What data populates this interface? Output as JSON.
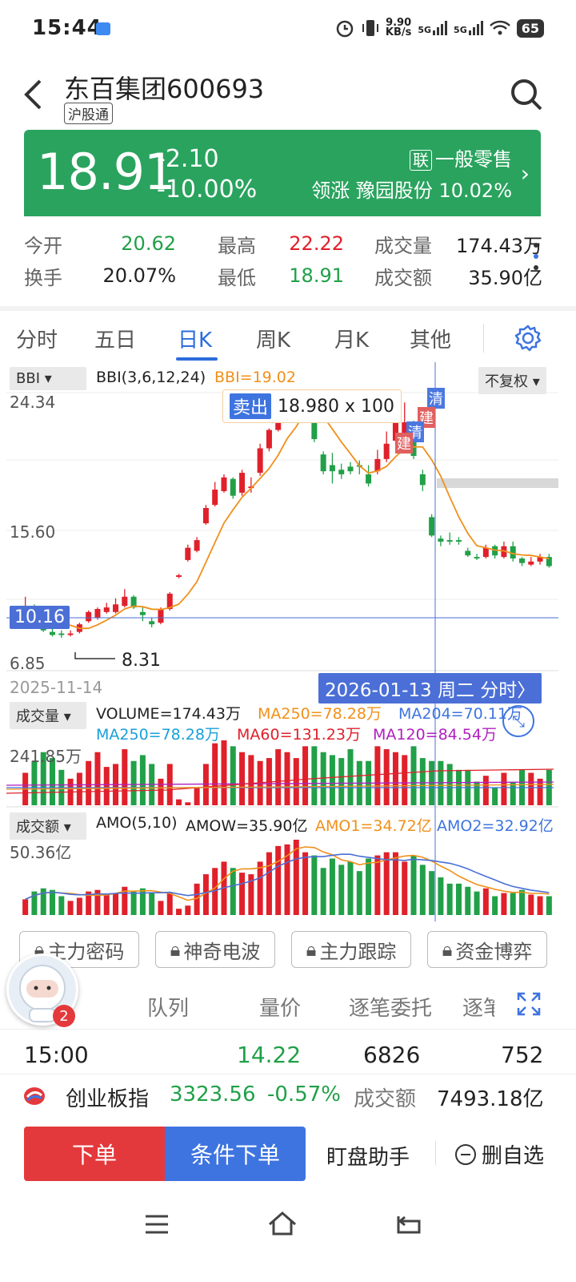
{
  "status": {
    "time": "15:44",
    "speed_top": "9.90",
    "speed_unit": "KB/s",
    "net1": "5G",
    "net2": "5G",
    "battery": "65"
  },
  "header": {
    "title": "东百集团600693",
    "tag": "沪股通"
  },
  "quote": {
    "price": "18.91",
    "change": "-2.10",
    "change_pct": "-10.00%",
    "lian_badge": "联",
    "sector": "一般零售",
    "leader_label": "领涨",
    "leader": "豫园股份 10.02%",
    "color_down": "#2aa35e"
  },
  "stats": {
    "open_label": "今开",
    "open": "20.62",
    "high_label": "最高",
    "high": "22.22",
    "vol_label": "成交量",
    "vol": "174.43万",
    "turnover_label": "换手",
    "turnover": "20.07%",
    "low_label": "最低",
    "low": "18.91",
    "amount_label": "成交额",
    "amount": "35.90亿"
  },
  "tabs": [
    "分时",
    "五日",
    "日K",
    "周K",
    "月K",
    "其他"
  ],
  "chart": {
    "indicator_select": "BBI",
    "indicator_name": "BBI(3,6,12,24)",
    "indicator_value": "BBI=19.02",
    "adjust_select": "不复权",
    "y_high": "24.34",
    "y_mid": "15.60",
    "y_low": "6.85",
    "crosshair_price": "10.16",
    "low_mark": "8.31",
    "tooltip_sell_label": "卖出",
    "tooltip_sell_value": "18.980 x 100",
    "mark_jian": "建",
    "mark_qing": "清",
    "date_left": "2025-11-14",
    "date_cursor": "2026-01-13 周二 分时〉",
    "vol_select": "成交量",
    "vol_text": "VOLUME=174.43万",
    "vol_ma250": "MA250=78.28万",
    "vol_ma204": "MA204=70.11万",
    "vol_ma250b": "MA250=78.28万",
    "vol_ma60": "MA60=131.23万",
    "vol_ma120": "MA120=84.54万",
    "vol_max": "241.85万",
    "amo_select": "成交额",
    "amo_text": "AMO(5,10)",
    "amow": "AMOW=35.90亿",
    "amo1": "AMO1=34.72亿",
    "amo2": "AMO2=32.92亿",
    "amo_max": "50.36亿"
  },
  "chart_data": {
    "type": "candlestick",
    "ylim": [
      6.85,
      24.34
    ],
    "candles": [
      {
        "o": 10.3,
        "c": 10.4,
        "h": 11.0,
        "l": 10.0
      },
      {
        "o": 10.2,
        "c": 10.0,
        "h": 10.5,
        "l": 9.9
      },
      {
        "o": 8.9,
        "c": 8.8,
        "h": 9.0,
        "l": 8.7
      },
      {
        "o": 8.7,
        "c": 8.5,
        "h": 8.9,
        "l": 8.4
      },
      {
        "o": 8.6,
        "c": 8.5,
        "h": 8.8,
        "l": 8.31
      },
      {
        "o": 8.5,
        "c": 8.6,
        "h": 8.8,
        "l": 8.4
      },
      {
        "o": 8.7,
        "c": 9.2,
        "h": 9.3,
        "l": 8.6
      },
      {
        "o": 9.4,
        "c": 10.0,
        "h": 10.1,
        "l": 9.3
      },
      {
        "o": 9.6,
        "c": 10.2,
        "h": 10.3,
        "l": 9.5
      },
      {
        "o": 10.0,
        "c": 10.3,
        "h": 10.6,
        "l": 9.9
      },
      {
        "o": 10.0,
        "c": 10.5,
        "h": 10.9,
        "l": 9.9
      },
      {
        "o": 10.4,
        "c": 11.0,
        "h": 11.5,
        "l": 10.3
      },
      {
        "o": 11.0,
        "c": 10.3,
        "h": 11.1,
        "l": 10.2
      },
      {
        "o": 10.0,
        "c": 9.8,
        "h": 10.3,
        "l": 9.4
      },
      {
        "o": 9.4,
        "c": 9.2,
        "h": 9.6,
        "l": 9.0
      },
      {
        "o": 9.3,
        "c": 10.2,
        "h": 10.3,
        "l": 9.2
      },
      {
        "o": 10.2,
        "c": 11.2,
        "h": 11.3,
        "l": 10.1
      },
      {
        "o": 12.3,
        "c": 12.4,
        "h": 12.5,
        "l": 12.2
      },
      {
        "o": 13.4,
        "c": 14.2,
        "h": 14.4,
        "l": 13.3
      },
      {
        "o": 14.0,
        "c": 14.7,
        "h": 14.9,
        "l": 13.9
      },
      {
        "o": 15.8,
        "c": 16.8,
        "h": 17.0,
        "l": 15.7
      },
      {
        "o": 17.0,
        "c": 18.0,
        "h": 18.5,
        "l": 16.9
      },
      {
        "o": 17.9,
        "c": 18.8,
        "h": 19.0,
        "l": 17.8
      },
      {
        "o": 18.7,
        "c": 17.6,
        "h": 18.8,
        "l": 17.4
      },
      {
        "o": 17.8,
        "c": 19.1,
        "h": 19.3,
        "l": 17.6
      },
      {
        "o": 18.1,
        "c": 18.2,
        "h": 18.8,
        "l": 17.8
      },
      {
        "o": 19.1,
        "c": 20.7,
        "h": 21.0,
        "l": 18.9
      },
      {
        "o": 20.7,
        "c": 21.9,
        "h": 22.0,
        "l": 20.5
      },
      {
        "o": 21.9,
        "c": 24.0,
        "h": 24.2,
        "l": 21.8
      },
      {
        "o": 24.0,
        "c": 24.1,
        "h": 24.34,
        "l": 23.3
      },
      {
        "o": 23.3,
        "c": 23.8,
        "h": 24.0,
        "l": 23.0
      },
      {
        "o": 23.9,
        "c": 24.2,
        "h": 24.3,
        "l": 23.5
      },
      {
        "o": 24.3,
        "c": 21.3,
        "h": 24.34,
        "l": 21.1
      },
      {
        "o": 20.3,
        "c": 19.2,
        "h": 20.5,
        "l": 19.0
      },
      {
        "o": 19.6,
        "c": 19.2,
        "h": 20.4,
        "l": 18.4
      },
      {
        "o": 19.3,
        "c": 19.0,
        "h": 19.7,
        "l": 18.7
      },
      {
        "o": 19.5,
        "c": 19.2,
        "h": 19.8,
        "l": 19.0
      },
      {
        "o": 19.6,
        "c": 19.5,
        "h": 19.9,
        "l": 19.0
      },
      {
        "o": 19.0,
        "c": 18.4,
        "h": 19.6,
        "l": 18.2
      },
      {
        "o": 19.2,
        "c": 20.0,
        "h": 20.6,
        "l": 19.0
      },
      {
        "o": 20.0,
        "c": 21.0,
        "h": 21.8,
        "l": 19.8
      },
      {
        "o": 21.2,
        "c": 22.8,
        "h": 23.5,
        "l": 21.0
      },
      {
        "o": 21.5,
        "c": 22.4,
        "h": 23.7,
        "l": 21.2
      },
      {
        "o": 22.2,
        "c": 20.2,
        "h": 22.5,
        "l": 20.0
      },
      {
        "o": 19.0,
        "c": 18.3,
        "h": 19.3,
        "l": 17.9
      },
      {
        "o": 16.2,
        "c": 15.0,
        "h": 16.4,
        "l": 14.9
      },
      {
        "o": 14.8,
        "c": 14.6,
        "h": 15.0,
        "l": 14.3
      },
      {
        "o": 14.7,
        "c": 14.6,
        "h": 15.2,
        "l": 14.4
      },
      {
        "o": 14.7,
        "c": 14.6,
        "h": 14.9,
        "l": 14.4
      },
      {
        "o": 14.0,
        "c": 13.7,
        "h": 14.2,
        "l": 13.6
      },
      {
        "o": 13.6,
        "c": 13.5,
        "h": 13.8,
        "l": 13.4
      },
      {
        "o": 13.6,
        "c": 14.2,
        "h": 14.4,
        "l": 13.5
      },
      {
        "o": 14.3,
        "c": 13.7,
        "h": 14.4,
        "l": 13.5
      },
      {
        "o": 13.6,
        "c": 14.3,
        "h": 14.6,
        "l": 13.5
      },
      {
        "o": 14.3,
        "c": 13.5,
        "h": 14.6,
        "l": 13.3
      },
      {
        "o": 13.5,
        "c": 13.2,
        "h": 13.6,
        "l": 13.0
      },
      {
        "o": 13.1,
        "c": 13.3,
        "h": 13.6,
        "l": 13.0
      },
      {
        "o": 13.3,
        "c": 13.6,
        "h": 13.8,
        "l": 13.1
      },
      {
        "o": 13.6,
        "c": 13.0,
        "h": 13.8,
        "l": 12.9
      }
    ],
    "volume": [
      110,
      150,
      180,
      160,
      120,
      90,
      110,
      150,
      180,
      130,
      140,
      190,
      150,
      170,
      140,
      90,
      140,
      20,
      10,
      60,
      140,
      210,
      220,
      200,
      180,
      170,
      150,
      160,
      190,
      180,
      160,
      200,
      200,
      180,
      170,
      160,
      190,
      150,
      150,
      200,
      190,
      180,
      170,
      200,
      160,
      150,
      150,
      140,
      120,
      120,
      80,
      100,
      60,
      110,
      80,
      120,
      110,
      90,
      120
    ],
    "amount": [
      10,
      15,
      17,
      16,
      12,
      9,
      11,
      15,
      16,
      13,
      14,
      18,
      15,
      17,
      14,
      9,
      14,
      4,
      6,
      20,
      26,
      30,
      34,
      30,
      27,
      26,
      34,
      40,
      44,
      45,
      48,
      40,
      38,
      30,
      36,
      32,
      34,
      28,
      36,
      38,
      40,
      40,
      34,
      38,
      32,
      28,
      24,
      20,
      20,
      18,
      15,
      17,
      12,
      14,
      14,
      16,
      13,
      12,
      12
    ]
  },
  "lock_buttons": [
    "主力密码",
    "神奇电波",
    "主力跟踪",
    "资金博弈"
  ],
  "bottom_tabs": [
    "队列",
    "量价",
    "逐笔委托",
    "逐笔"
  ],
  "badge_count": "2",
  "tick": {
    "time": "15:00",
    "price": "14.22",
    "vol": "6826",
    "count": "752"
  },
  "index": {
    "name": "创业板指",
    "value": "3323.56",
    "pct": "-0.57%",
    "amount_label": "成交额",
    "amount": "7493.18亿"
  },
  "actions": {
    "order": "下单",
    "cond_order": "条件下单",
    "assistant": "盯盘助手",
    "remove_fav": "删自选"
  }
}
